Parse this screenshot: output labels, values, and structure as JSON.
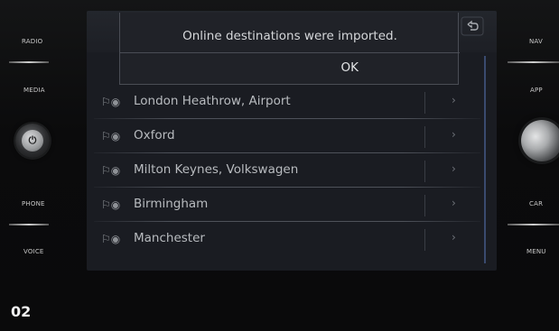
{
  "dialog": {
    "message": "Online destinations were imported.",
    "ok_label": "OK"
  },
  "hardware": {
    "left_buttons": [
      "RADIO",
      "MEDIA",
      "PHONE",
      "VOICE"
    ],
    "right_buttons": [
      "NAV",
      "APP",
      "CAR",
      "MENU"
    ]
  },
  "destinations": [
    {
      "label": "London Heathrow, Airport"
    },
    {
      "label": "Oxford"
    },
    {
      "label": "Milton Keynes, Volkswagen"
    },
    {
      "label": "Birmingham"
    },
    {
      "label": "Manchester"
    }
  ],
  "icons": {
    "row_icon": "destination-flag-icon",
    "row_action": "chevron-right-icon",
    "back": "back-arrow-icon",
    "left_knob": "power-icon"
  },
  "figure_label": "02",
  "colors": {
    "screen_bg": "#1a1c22",
    "dialog_bg": "#202228",
    "text": "#b8bbbf"
  }
}
